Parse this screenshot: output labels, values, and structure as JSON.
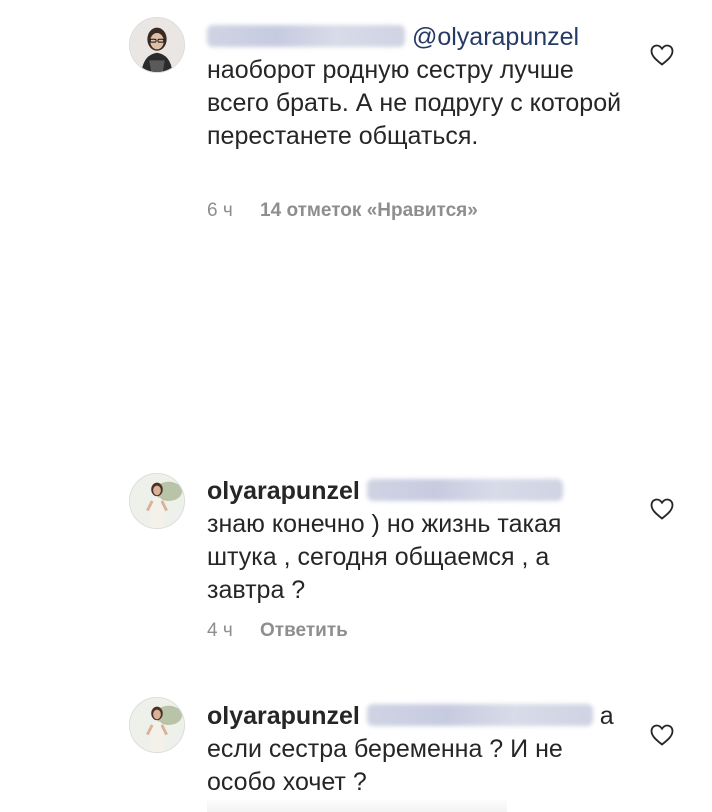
{
  "comments": [
    {
      "author_blurred": true,
      "mention": "@olyarapunzel",
      "text": "наоборот родную сестру лучше всего брать. А не подругу с которой перестанете общаться.",
      "time": "6 ч",
      "likes": "14 отметок «Нравится»"
    },
    {
      "author": "olyarapunzel",
      "mention_blurred": true,
      "text": "знаю конечно ) но жизнь такая штука , сегодня общаемся , а завтра ?",
      "time": "4 ч",
      "reply": "Ответить"
    },
    {
      "author": "olyarapunzel",
      "mention_blurred": true,
      "text_first": "а",
      "text": "если сестра беременна ? И не особо хочет ?"
    }
  ],
  "icons": {
    "heart": "heart-outline-icon",
    "avatar": "user-avatar"
  },
  "colors": {
    "text": "#262626",
    "meta": "#8e8e8e",
    "mention": "#263a66",
    "background": "#ffffff"
  }
}
